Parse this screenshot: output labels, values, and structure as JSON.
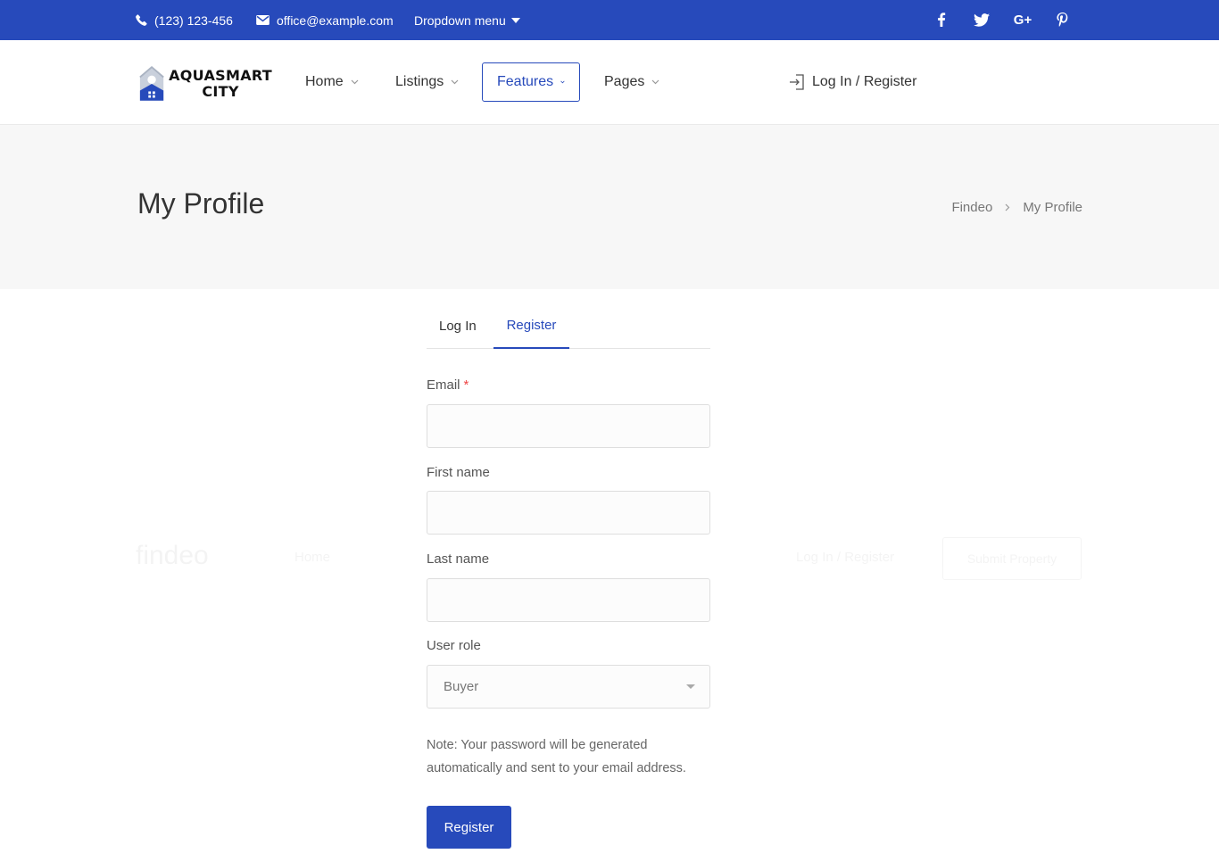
{
  "topbar": {
    "phone": "(123) 123-456",
    "email": "office@example.com",
    "dropdown": "Dropdown menu",
    "social": [
      {
        "icon": "facebook-icon",
        "glyph": "f"
      },
      {
        "icon": "twitter-icon",
        "glyph": "t"
      },
      {
        "icon": "google-plus-icon",
        "glyph": "G+"
      },
      {
        "icon": "pinterest-icon",
        "glyph": "p"
      }
    ]
  },
  "header": {
    "logo_line1": "AQUASMART",
    "logo_line2": "CITY",
    "nav": [
      {
        "label": "Home"
      },
      {
        "label": "Listings"
      },
      {
        "label": "Features"
      },
      {
        "label": "Pages"
      }
    ],
    "login": "Log In / Register"
  },
  "title_band": {
    "title": "My Profile",
    "breadcrumb": [
      "Findeo",
      "My Profile"
    ]
  },
  "ghost": {
    "logo": "findeo",
    "nav_home": "Home",
    "login": "Log In / Register",
    "button": "Submit Property"
  },
  "tabs": {
    "login": "Log In",
    "register": "Register"
  },
  "form": {
    "email_label": "Email",
    "email_required": "*",
    "email_value": "",
    "first_name_label": "First name",
    "first_name_value": "",
    "last_name_label": "Last name",
    "last_name_value": "",
    "role_label": "User role",
    "role_selected": "Buyer",
    "note": "Note: Your password will be generated automatically and sent to your email address.",
    "submit": "Register"
  },
  "colors": {
    "accent": "#274abb",
    "title_band_bg": "#f7f7f7",
    "required": "#ee4444"
  }
}
